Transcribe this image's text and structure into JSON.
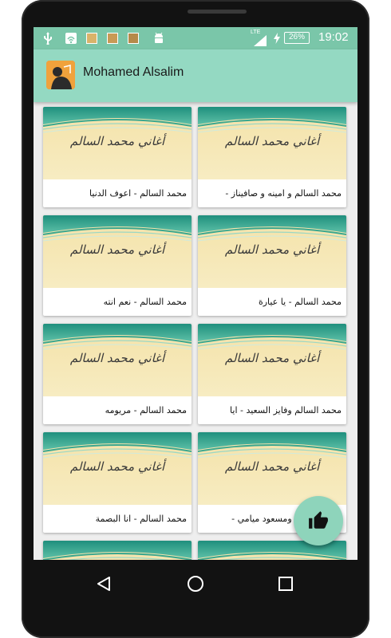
{
  "status_bar": {
    "network": "LTE",
    "battery": "26%",
    "time": "19:02"
  },
  "app_bar": {
    "title": "Mohamed Alsalim"
  },
  "thumbnail_title": "أغاني محمد السالم",
  "items": [
    {
      "label": "محمد السالم و امينه و صافيناز -"
    },
    {
      "label": "محمد السالم - اعوف الدنيا"
    },
    {
      "label": "محمد السالم - يا عيارة"
    },
    {
      "label": "محمد السالم - نعم انته"
    },
    {
      "label": "محمد السالم وفايز السعيد - ايا"
    },
    {
      "label": "محمد السالم - مريومه"
    },
    {
      "label": "محمد السالم ومسعود ميامي -"
    },
    {
      "label": "محمد السالم - انا البصمة"
    }
  ],
  "fab": {
    "icon": "thumbs-up-icon"
  },
  "nav": {
    "back_icon": "back-icon",
    "home_icon": "home-icon",
    "recents_icon": "recents-icon"
  },
  "colors": {
    "status_bar": "#7ac6a9",
    "app_bar": "#94d9c2",
    "fab": "#8ed4bb"
  }
}
